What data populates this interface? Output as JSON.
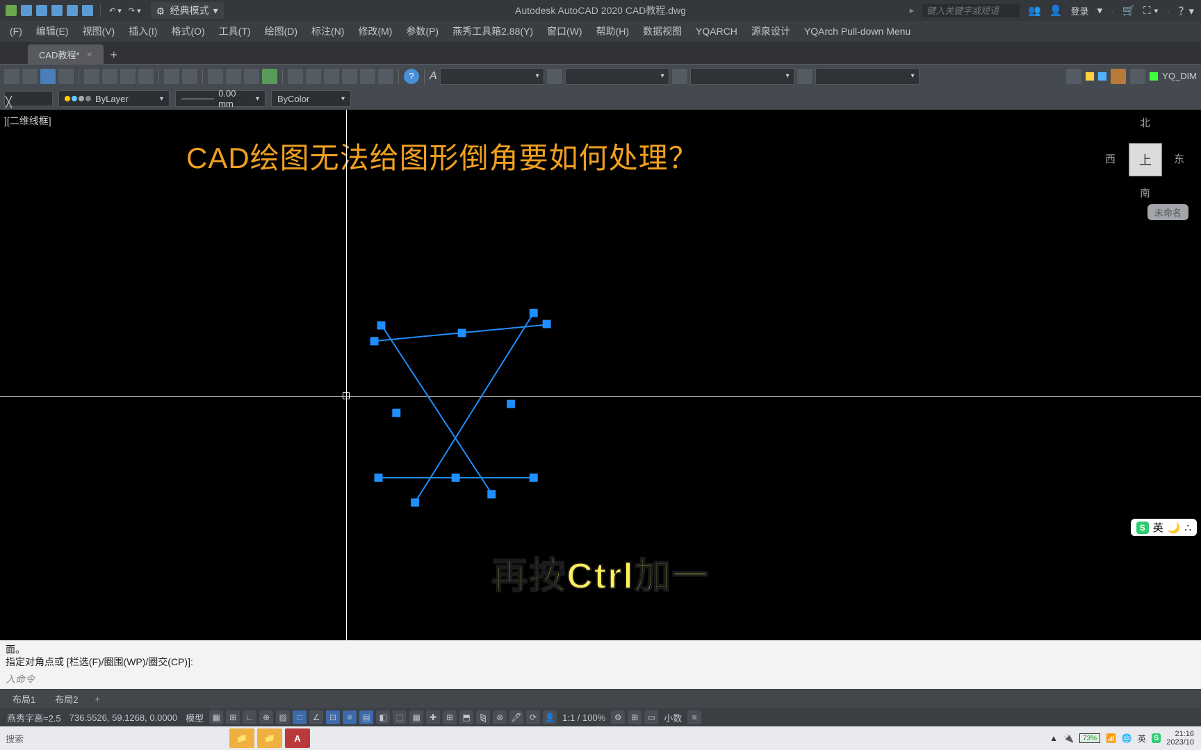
{
  "titlebar": {
    "workspace": "经典模式",
    "app_title": "Autodesk AutoCAD 2020   CAD教程.dwg",
    "search_placeholder": "键入关键字或短语",
    "login": "登录"
  },
  "menu": {
    "items": [
      "(F)",
      "编辑(E)",
      "视图(V)",
      "插入(I)",
      "格式(O)",
      "工具(T)",
      "绘图(D)",
      "标注(N)",
      "修改(M)",
      "参数(P)",
      "燕秀工具箱2.88(Y)",
      "窗口(W)",
      "帮助(H)",
      "数据视图",
      "YQARCH",
      "源泉设计",
      "YQArch Pull-down Menu"
    ]
  },
  "tabs": {
    "active": "CAD教程*"
  },
  "propbar": {
    "layer_name": "ByLayer",
    "lineweight": "0.00 mm",
    "color_mode": "ByColor"
  },
  "yq_dim": "YQ_DIM",
  "viewport_label": "][二维线框]",
  "viewcube": {
    "face": "上",
    "n": "北",
    "s": "南",
    "w": "西",
    "e": "东",
    "unnamed": "未命名"
  },
  "question_text": "CAD绘图无法给图形倒角要如何处理？",
  "caption_text": "再按Ctrl加一",
  "sogou": {
    "lang": "英"
  },
  "cmd": {
    "line1": "面。",
    "line2": "指定对角点或 [栏选(F)/圈围(WP)/圈交(CP)]:",
    "prompt": "入命令",
    "close_x": "╳"
  },
  "mltabs": {
    "layout1": "布局1",
    "layout2": "布局2"
  },
  "status": {
    "ys_height": "燕秀字高=2.5",
    "coords": "736.5526, 59.1268, 0.0000",
    "model": "模型",
    "scale": "1:1 / 100%",
    "units": "小数"
  },
  "taskbar": {
    "search": "搜索",
    "battery": "73%",
    "ime": "英",
    "time": "21:16",
    "date": "2023/10"
  }
}
